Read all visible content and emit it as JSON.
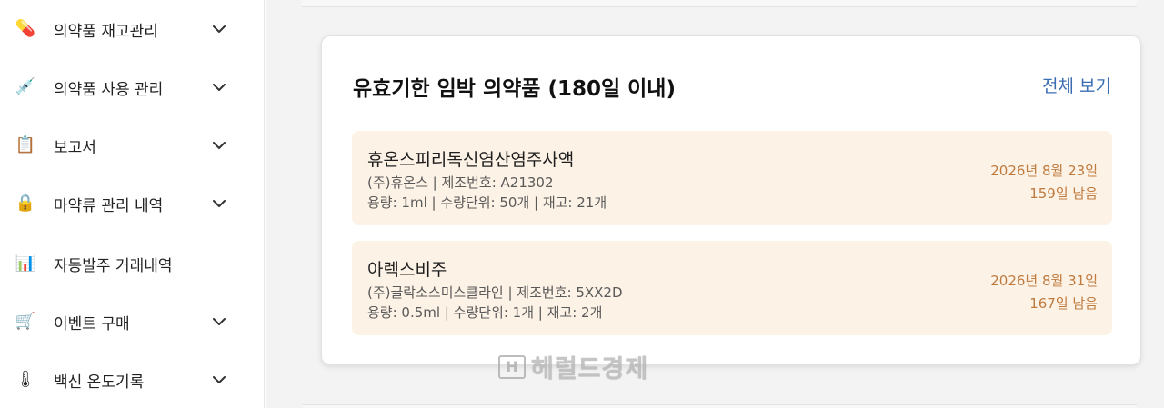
{
  "sidebar": {
    "items": [
      {
        "label": "의약품 재고관리",
        "icon": "pill-icon",
        "glyph": "💊",
        "expandable": true
      },
      {
        "label": "의약품 사용 관리",
        "icon": "syringe-icon",
        "glyph": "💉",
        "expandable": true
      },
      {
        "label": "보고서",
        "icon": "clipboard-icon",
        "glyph": "📋",
        "expandable": true
      },
      {
        "label": "마약류 관리 내역",
        "icon": "lock-icon",
        "glyph": "🔒",
        "expandable": true
      },
      {
        "label": "자동발주 거래내역",
        "icon": "bar-chart-icon",
        "glyph": "📊",
        "expandable": false
      },
      {
        "label": "이벤트 구매",
        "icon": "shopping-cart-icon",
        "glyph": "🛒",
        "expandable": true
      },
      {
        "label": "백신 온도기록",
        "icon": "thermometer-icon",
        "glyph": "🌡",
        "expandable": true
      }
    ]
  },
  "card": {
    "title": "유효기한 임박 의약품 (180일 이내)",
    "view_all": "전체 보기",
    "items": [
      {
        "name": "휴온스피리독신염산염주사액",
        "maker_line": "(주)휴온스 | 제조번호: A21302",
        "spec_line": "용량: 1ml | 수량단위: 50개 | 재고: 21개",
        "date": "2026년 8월 23일",
        "remaining": "159일 남음"
      },
      {
        "name": "아렉스비주",
        "maker_line": "(주)글락소스미스클라인 | 제조번호: 5XX2D",
        "spec_line": "용량: 0.5ml | 수량단위: 1개 | 재고: 2개",
        "date": "2026년 8월 31일",
        "remaining": "167일 남음"
      }
    ]
  },
  "watermark": {
    "logo": "H",
    "text": "헤럴드경제"
  },
  "colors": {
    "item_background": "#fdf2e6",
    "date_accent": "#bf7a3e",
    "link": "#3b6db3"
  }
}
